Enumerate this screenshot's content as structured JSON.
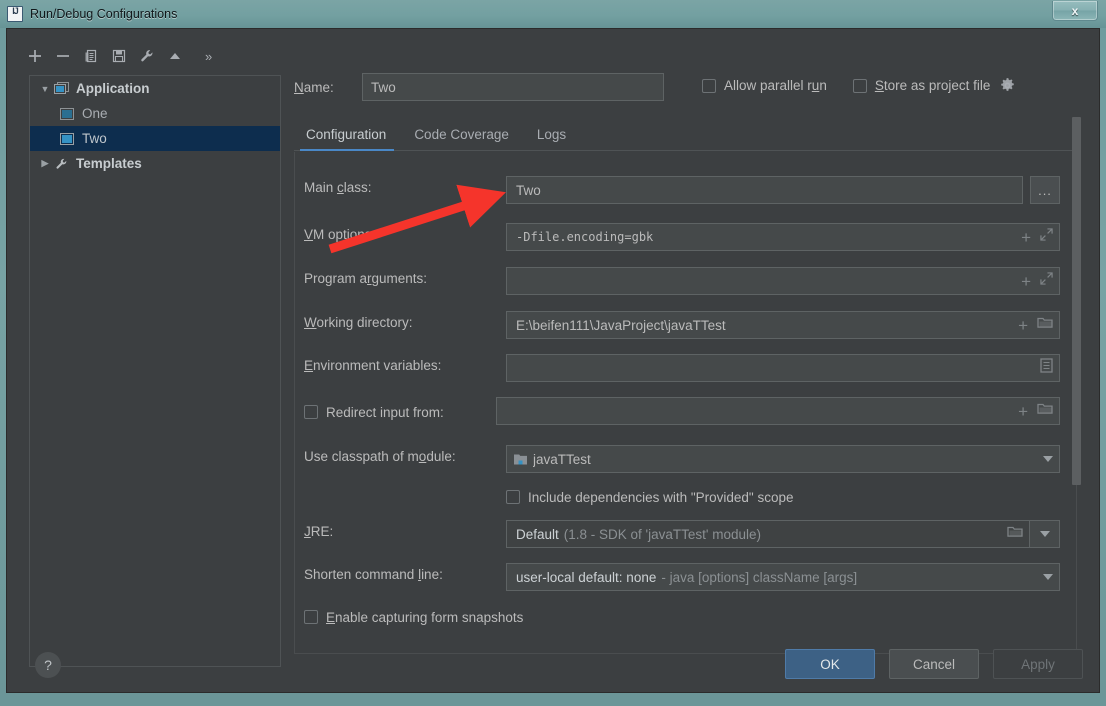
{
  "window": {
    "title": "Run/Debug Configurations",
    "app_icon": "intellij-idea-icon",
    "close_label": "x"
  },
  "toolbar": {
    "buttons": [
      {
        "name": "add-configuration-button",
        "icon": "plus-icon",
        "label": "+"
      },
      {
        "name": "remove-configuration-button",
        "icon": "minus-icon",
        "label": "−"
      },
      {
        "name": "copy-configuration-button",
        "icon": "copy-icon",
        "label": "Copy"
      },
      {
        "name": "save-configuration-button",
        "icon": "save-icon",
        "label": "Save"
      },
      {
        "name": "edit-templates-button",
        "icon": "wrench-icon",
        "label": "Edit Templates"
      },
      {
        "name": "move-up-button",
        "icon": "arrow-up-icon",
        "label": "Move Up"
      }
    ],
    "more_label": "»"
  },
  "tree": {
    "items": [
      {
        "label": "Application",
        "level": 0,
        "expander": "▼",
        "icon": "application-icon",
        "selected": false,
        "bold": true
      },
      {
        "label": "One",
        "level": 1,
        "expander": "",
        "icon": "run-config-icon",
        "selected": false,
        "bold": false
      },
      {
        "label": "Two",
        "level": 1,
        "expander": "",
        "icon": "run-config-icon",
        "selected": true,
        "bold": false
      },
      {
        "label": "Templates",
        "level": 0,
        "expander": "▶",
        "icon": "wrench-icon",
        "selected": false,
        "bold": true
      }
    ]
  },
  "header": {
    "name_label": "Name:",
    "name_label_mnemonic": "N",
    "name_value": "Two",
    "name_placeholder": "",
    "allow_parallel_run_label": "Allow parallel run",
    "allow_parallel_run_checked": false,
    "store_as_project_file_label": "Store as project file",
    "store_as_project_file_checked": false,
    "gear_icon": "gear-icon"
  },
  "tabs": [
    {
      "label": "Configuration",
      "active": true
    },
    {
      "label": "Code Coverage",
      "active": false
    },
    {
      "label": "Logs",
      "active": false
    }
  ],
  "form": {
    "main_class": {
      "label": "Main class:",
      "value": "Two",
      "browse_label": "..."
    },
    "vm_options": {
      "label": "VM options:",
      "value": "-Dfile.encoding=gbk",
      "expand_icon": "expand-diagonal-icon",
      "macro_icon": "plus-icon"
    },
    "program_arguments": {
      "label": "Program arguments:",
      "value": "",
      "expand_icon": "expand-diagonal-icon",
      "macro_icon": "plus-icon"
    },
    "working_directory": {
      "label": "Working directory:",
      "value": "E:\\beifen111\\JavaProject\\javaTTest",
      "folder_icon": "folder-icon",
      "macro_icon": "plus-icon"
    },
    "environment_variables": {
      "label": "Environment variables:",
      "value": "",
      "edit_icon": "list-edit-icon"
    },
    "redirect_input": {
      "label": "Redirect input from:",
      "checked": false,
      "value": "",
      "folder_icon": "folder-icon",
      "macro_icon": "plus-icon"
    },
    "use_classpath_of_module": {
      "label": "Use classpath of module:",
      "value": "javaTTest",
      "module_icon": "module-icon"
    },
    "include_dependencies": {
      "label": "Include dependencies with \"Provided\" scope",
      "checked": false
    },
    "jre": {
      "label": "JRE:",
      "value": "Default",
      "hint": "(1.8 - SDK of 'javaTTest' module)",
      "folder_icon": "folder-icon"
    },
    "shorten_command_line": {
      "label": "Shorten command line:",
      "value": "user-local default: none",
      "hint": "- java [options] className [args]"
    },
    "enable_form_snapshots": {
      "label": "Enable capturing form snapshots",
      "checked": false
    }
  },
  "footer": {
    "help_label": "?",
    "ok_label": "OK",
    "cancel_label": "Cancel",
    "apply_label": "Apply"
  },
  "annotation": {
    "type": "red-arrow",
    "color": "#f5342b",
    "points_to": "vm-options-field"
  },
  "colors": {
    "window_chrome": "#73a0a1",
    "dialog_bg": "#3c3f41",
    "field_bg": "#45494a",
    "selection_bg": "#0d2d4e",
    "tab_accent": "#4a88c7",
    "ok_button": "#3d6185",
    "annotation_red": "#f5342b"
  }
}
